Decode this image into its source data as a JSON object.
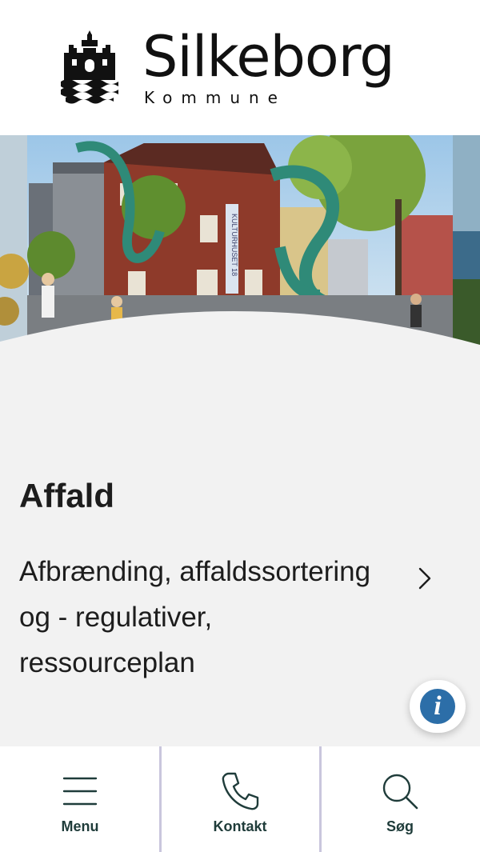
{
  "header": {
    "logo_name": "Silkeborg",
    "logo_sub": "Kommune",
    "crest_icon": "silkeborg-crest-icon"
  },
  "main": {
    "title": "Affald",
    "subtitle": "Afbrænding, affaldssortering og - regulativer, ressourceplan",
    "hero_sign": "KULTURHUSET 18"
  },
  "info_button": {
    "label": "i",
    "color": "#2c6ea8"
  },
  "bottom_nav": {
    "items": [
      {
        "label": "Menu",
        "icon": "hamburger-menu-icon"
      },
      {
        "label": "Kontakt",
        "icon": "phone-icon"
      },
      {
        "label": "Søg",
        "icon": "search-icon"
      }
    ]
  },
  "colors": {
    "page_bg": "#f2f2f2",
    "nav_text": "#1f3c3a",
    "divider": "#c9c6dd"
  }
}
